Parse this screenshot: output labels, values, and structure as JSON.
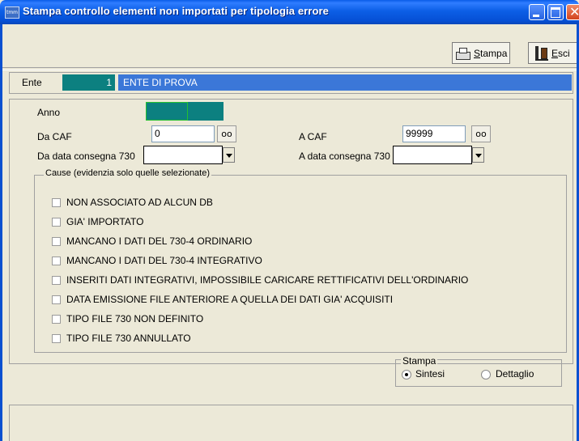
{
  "window": {
    "title": "Stampa controllo elementi non importati per tipologia errore",
    "icon_text": "tmm",
    "close_glyph": "✕"
  },
  "toolbar": {
    "print_label": "Stampa",
    "exit_label": "Esci"
  },
  "ente": {
    "label": "Ente",
    "code": "1",
    "name": "ENTE DI PROVA"
  },
  "form": {
    "anno_label": "Anno",
    "da_caf_label": "Da CAF",
    "da_caf_value": "0",
    "a_caf_label": "A CAF",
    "a_caf_value": "99999",
    "lookup_glyph": "oo",
    "da_data_label": "Da data consegna 730",
    "a_data_label": "A data consegna 730"
  },
  "causes": {
    "title": "Cause (evidenzia solo quelle selezionate)",
    "items": [
      "NON ASSOCIATO AD ALCUN DB",
      "GIA' IMPORTATO",
      "MANCANO I DATI DEL 730-4 ORDINARIO",
      "MANCANO I DATI DEL 730-4 INTEGRATIVO",
      "INSERITI DATI INTEGRATIVI, IMPOSSIBILE CARICARE RETTIFICATIVI DELL'ORDINARIO",
      "DATA EMISSIONE FILE ANTERIORE A QUELLA DEI DATI GIA' ACQUISITI",
      "TIPO FILE 730 NON DEFINITO",
      "TIPO FILE 730 ANNULLATO"
    ]
  },
  "print_mode": {
    "title": "Stampa",
    "option_sintesi": "Sintesi",
    "option_dettaglio": "Dettaglio",
    "selected": "Sintesi"
  },
  "colors": {
    "titlebar": "#0c5fe6",
    "ente_code_bg": "#0c8080",
    "ente_name_bg": "#3b77d8"
  }
}
